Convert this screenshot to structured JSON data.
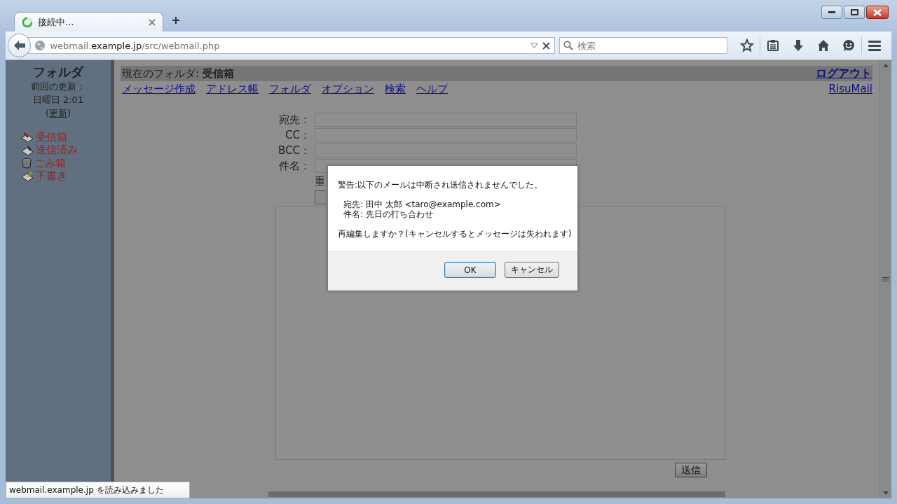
{
  "tab": {
    "title": "接続中...",
    "loading": true
  },
  "address_bar": {
    "url_prefix": "webmail.",
    "url_domain": "example.jp",
    "url_path": "/src/webmail.php"
  },
  "search": {
    "placeholder": "検索"
  },
  "sidebar": {
    "title": "フォルダ",
    "last_update_label": "前回の更新：",
    "last_update_time": "日曜日 2:01",
    "refresh_prefix": "(",
    "refresh_link": "更新",
    "refresh_suffix": ")",
    "folders": [
      {
        "name": "受信箱",
        "kind": "inbox"
      },
      {
        "name": "送信済み",
        "kind": "sent"
      },
      {
        "name": "ごみ箱",
        "kind": "trash"
      },
      {
        "name": "下書き",
        "kind": "drafts"
      }
    ]
  },
  "header": {
    "current_folder": "現在のフォルダ: **受信箱**",
    "logout": "ログアウト",
    "brand": "RisuMail"
  },
  "nav_links": [
    "メッセージ作成",
    "アドレス帳",
    "フォルダ",
    "オプション",
    "検索",
    "ヘルプ"
  ],
  "compose": {
    "fields": [
      {
        "label": "宛先："
      },
      {
        "label": "CC："
      },
      {
        "label": "BCC："
      },
      {
        "label": "件名："
      }
    ],
    "partial_label": "重",
    "send_button": "送信"
  },
  "dialog": {
    "message": "警告:以下のメールは中断され送信されませんでした。",
    "details": [
      "宛先: 田中 太郎 <taro@example.com>",
      "件名: 先日の打ち合わせ"
    ],
    "question": "再編集しますか？(キャンセルするとメッセージは失われます)",
    "buttons": [
      {
        "label": "OK",
        "focused": true
      },
      {
        "label": "キャンセル",
        "focused": false
      }
    ]
  },
  "status": "webmail.example.jp を読み込みました"
}
